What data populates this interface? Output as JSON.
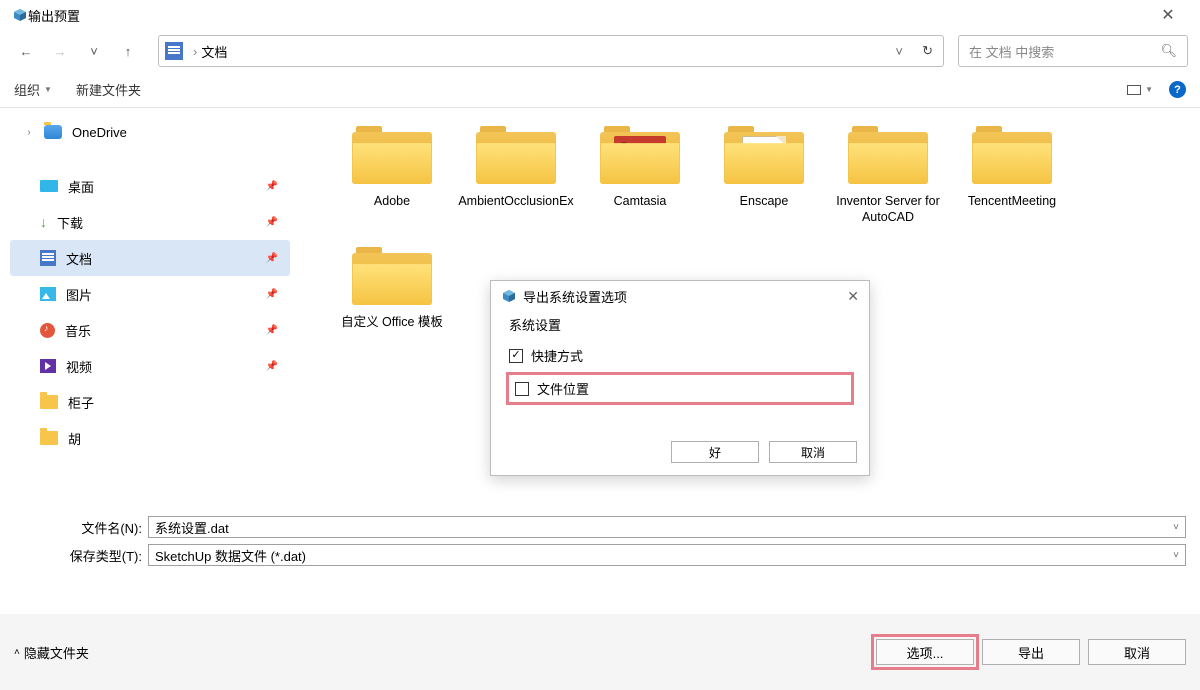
{
  "window": {
    "title": "输出预置"
  },
  "breadcrumb": {
    "location": "文档"
  },
  "search": {
    "placeholder": "在 文档 中搜索"
  },
  "toolbar": {
    "organize": "组织",
    "new_folder": "新建文件夹"
  },
  "tree": {
    "onedrive": "OneDrive",
    "desktop": "桌面",
    "downloads": "下载",
    "documents": "文档",
    "pictures": "图片",
    "music": "音乐",
    "videos": "视频",
    "guizi": "柜子",
    "hu": "胡"
  },
  "files": [
    {
      "name": "Adobe",
      "thumb": "none"
    },
    {
      "name": "AmbientOcclusionEx",
      "thumb": "none"
    },
    {
      "name": "Camtasia",
      "thumb": "red"
    },
    {
      "name": "Enscape",
      "thumb": "white"
    },
    {
      "name": "Inventor Server for AutoCAD",
      "thumb": "none"
    },
    {
      "name": "TencentMeeting",
      "thumb": "none"
    },
    {
      "name": "自定义 Office 模板",
      "thumb": "none"
    }
  ],
  "fields": {
    "filename_label": "文件名(N):",
    "filename_value": "系统设置.dat",
    "filetype_label": "保存类型(T):",
    "filetype_value": "SketchUp 数据文件 (*.dat)"
  },
  "footer": {
    "hide_folders": "隐藏文件夹",
    "options": "选项...",
    "export": "导出",
    "cancel": "取消"
  },
  "modal": {
    "title": "导出系统设置选项",
    "section": "系统设置",
    "shortcut": "快捷方式",
    "file_location": "文件位置",
    "shortcut_checked": true,
    "file_location_checked": false,
    "ok": "好",
    "cancel": "取消"
  }
}
